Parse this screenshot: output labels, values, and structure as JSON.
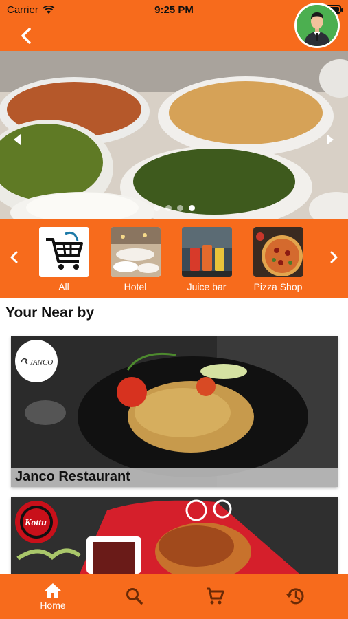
{
  "status_bar": {
    "carrier": "Carrier",
    "time": "9:25 PM"
  },
  "colors": {
    "accent": "#F76B1C",
    "avatar_bg": "#4CAF50"
  },
  "hero": {
    "slide_count": 4,
    "active_slide": 4
  },
  "categories": [
    {
      "label": "All",
      "icon": "shopping-cart-icon"
    },
    {
      "label": "Hotel",
      "icon": "hotel-thumbnail"
    },
    {
      "label": "Juice bar",
      "icon": "juice-bar-thumbnail"
    },
    {
      "label": "Pizza Shop",
      "icon": "pizza-thumbnail"
    }
  ],
  "nearby": {
    "title": "Your Near by",
    "restaurants": [
      {
        "name": "Janco Restaurant",
        "logo_text": "JANCO"
      },
      {
        "name": "",
        "logo_text": "Kottu"
      }
    ]
  },
  "bottom_nav": {
    "items": [
      {
        "label": "Home",
        "icon": "home-icon",
        "active": true
      },
      {
        "label": "",
        "icon": "search-icon"
      },
      {
        "label": "",
        "icon": "cart-icon"
      },
      {
        "label": "",
        "icon": "history-icon"
      }
    ]
  }
}
